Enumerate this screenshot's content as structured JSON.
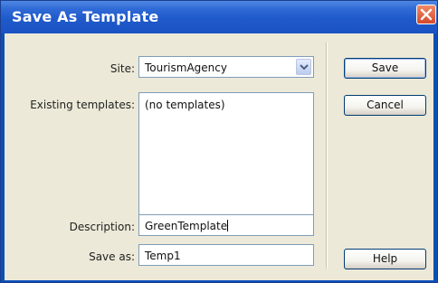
{
  "window": {
    "title": "Save As Template"
  },
  "form": {
    "site_label": "Site:",
    "site_value": "TourismAgency",
    "existing_label": "Existing templates:",
    "existing_items": [
      "(no templates)"
    ],
    "description_label": "Description:",
    "description_value": "GreenTemplate",
    "saveas_label": "Save as:",
    "saveas_value": "Temp1"
  },
  "buttons": {
    "save": "Save",
    "cancel": "Cancel",
    "help": "Help"
  },
  "icons": {
    "close": "close-icon",
    "dropdown": "chevron-down-icon"
  },
  "colors": {
    "titlebar": "#1f5acb",
    "close_button": "#d7482a",
    "dialog_background": "#ece9d8"
  }
}
